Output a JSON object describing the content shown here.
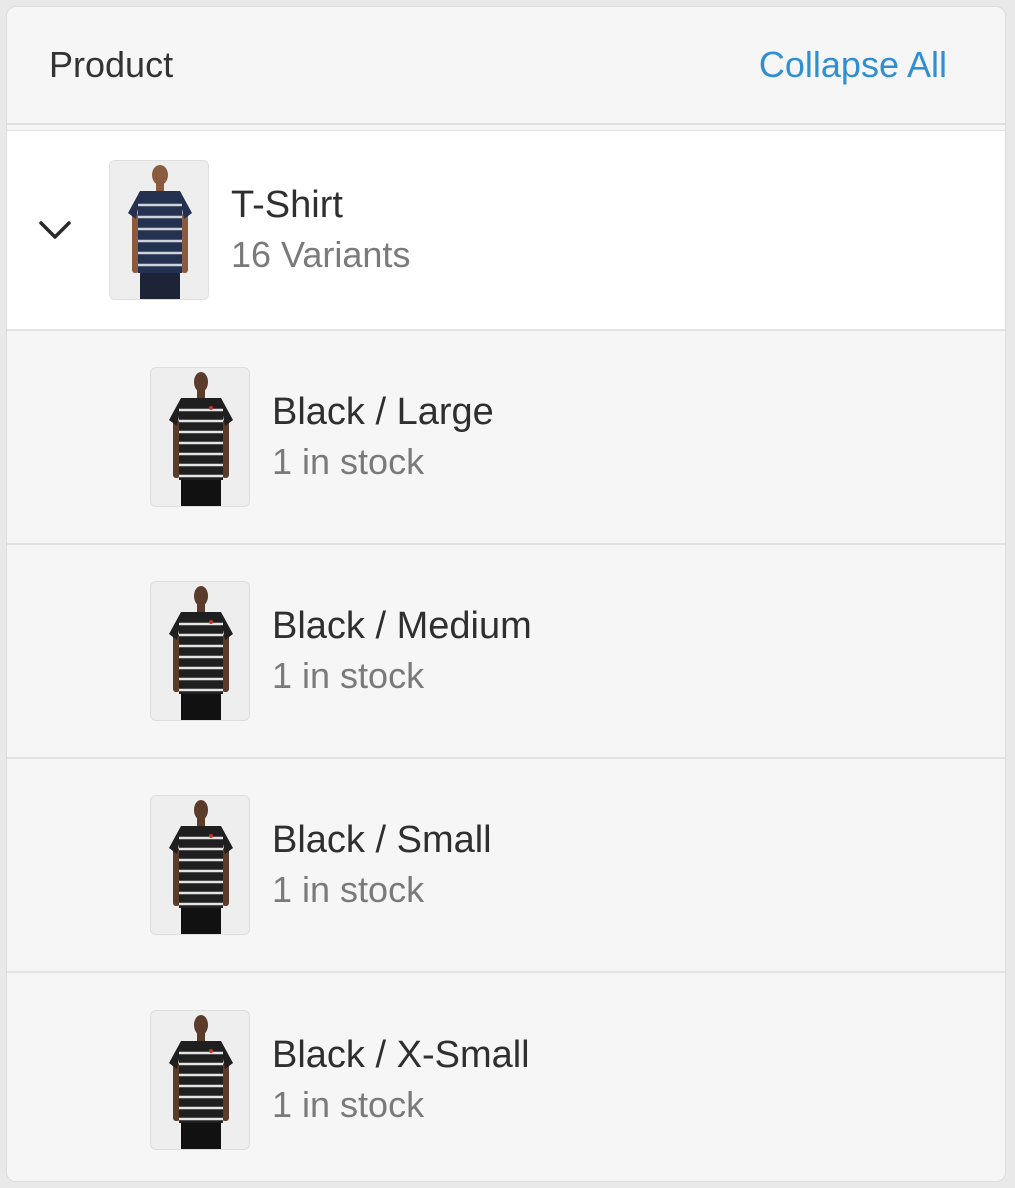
{
  "header": {
    "title": "Product",
    "collapse_label": "Collapse All"
  },
  "product": {
    "name": "T-Shirt",
    "variant_count_label": "16 Variants",
    "expanded_icon": "chevron-down-icon",
    "image_icon": "navy-striped-tshirt-photo"
  },
  "variants": [
    {
      "label": "Black / Large",
      "stock": "1 in stock"
    },
    {
      "label": "Black / Medium",
      "stock": "1 in stock"
    },
    {
      "label": "Black / Small",
      "stock": "1 in stock"
    },
    {
      "label": "Black / X-Small",
      "stock": "1 in stock"
    }
  ],
  "colors": {
    "link": "#2f8fd1",
    "navy_shirt": "#243150",
    "black_shirt": "#1f1f1f"
  }
}
